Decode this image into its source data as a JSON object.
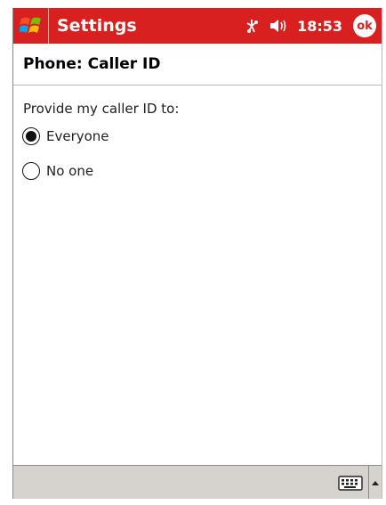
{
  "titlebar": {
    "app_title": "Settings",
    "clock": "18:53",
    "ok_label": "ok",
    "accent": "#d7201f"
  },
  "header": {
    "title": "Phone: Caller ID"
  },
  "form": {
    "prompt": "Provide my caller ID to:",
    "options": [
      {
        "label": "Everyone",
        "selected": true
      },
      {
        "label": "No one",
        "selected": false
      }
    ]
  },
  "icons": {
    "start": "windows-flag-icon",
    "connectivity": "connectivity-icon",
    "volume": "speaker-icon",
    "keyboard": "keyboard-icon",
    "sip": "chevron-up-icon"
  }
}
